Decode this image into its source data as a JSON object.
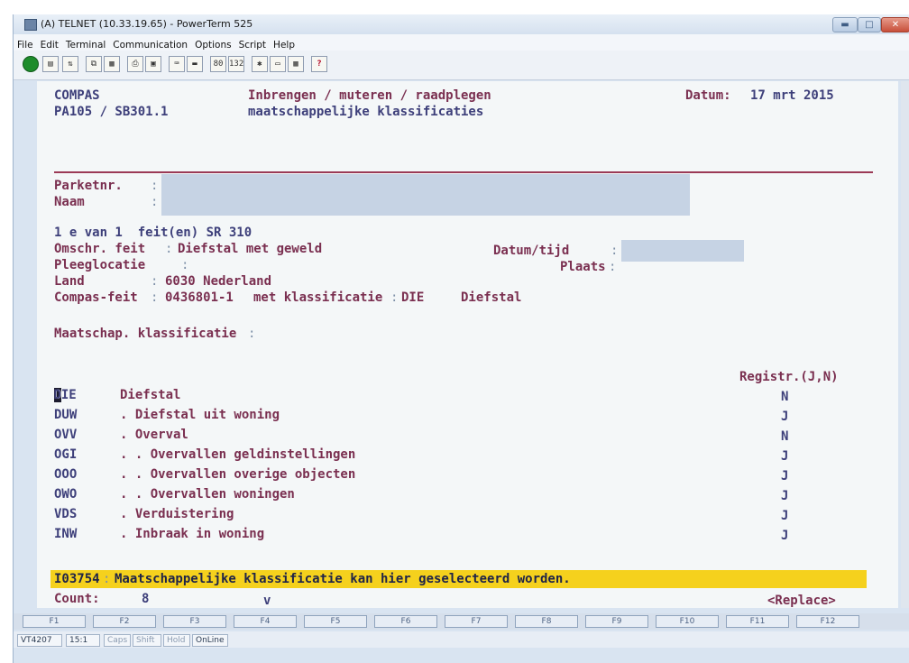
{
  "window": {
    "title": "(A) TELNET (10.33.19.65) - PowerTerm 525",
    "min_glyph": "▬",
    "max_glyph": "□",
    "close_glyph": "✕"
  },
  "menu": [
    "File",
    "Edit",
    "Terminal",
    "Communication",
    "Options",
    "Script",
    "Help"
  ],
  "toolbar": {
    "btn_80": "80",
    "btn_132": "132",
    "help": "?"
  },
  "screen": {
    "app": "COMPAS",
    "screen_id": "PA105 / SB301.1",
    "title_line1": "Inbrengen / muteren / raadplegen",
    "title_line2": "maatschappelijke klassificaties",
    "date_label": "Datum:",
    "date_value": "17 mrt 2015",
    "parketnr_label": "Parketnr.",
    "naam_label": "Naam",
    "colon": ":",
    "feit_count": "1 e van 1  feit(en) SR 310",
    "omschr_label": "Omschr. feit",
    "omschr_value": "Diefstal met geweld",
    "datumtijd_label": "Datum/tijd",
    "pleeg_label": "Pleeglocatie",
    "plaats_label": "Plaats",
    "land_label": "Land",
    "land_value": "6030 Nederland",
    "compas_label": "Compas-feit",
    "compas_value": "0436801-1",
    "met_klass_label": "met klassificatie",
    "klass_code": "DIE",
    "klass_name": "Diefstal",
    "maatschap_label": "Maatschap. klassificatie",
    "registr_label": "Registr.(J,N)",
    "rows": [
      {
        "code": "DIE",
        "desc": "Diefstal",
        "reg": "N"
      },
      {
        "code": "DUW",
        "desc": ". Diefstal uit woning",
        "reg": "J"
      },
      {
        "code": "OVV",
        "desc": ". Overval",
        "reg": "N"
      },
      {
        "code": "OGI",
        "desc": ". . Overvallen geldinstellingen",
        "reg": "J"
      },
      {
        "code": "OOO",
        "desc": ". . Overvallen overige objecten",
        "reg": "J"
      },
      {
        "code": "OWO",
        "desc": ". . Overvallen woningen",
        "reg": "J"
      },
      {
        "code": "VDS",
        "desc": ". Verduistering",
        "reg": "J"
      },
      {
        "code": "INW",
        "desc": ". Inbraak in woning",
        "reg": "J"
      }
    ],
    "message_code": "I03754",
    "message_text": "Maatschappelijke klassificatie kan hier geselecteerd worden.",
    "count_label": "Count:",
    "count_value": "8",
    "v_marker": "v",
    "replace": "<Replace>"
  },
  "fkeys": [
    "F1",
    "F2",
    "F3",
    "F4",
    "F5",
    "F6",
    "F7",
    "F8",
    "F9",
    "F10",
    "F11",
    "F12"
  ],
  "status": {
    "terminal": "VT4207",
    "line": "15:1",
    "caps": "Caps",
    "shift": "Shift",
    "hold": "Hold",
    "online": "OnLine"
  },
  "colors": {
    "highlight": "#f5d11d",
    "label_text": "#7a2f50",
    "value_text": "#3d3f7a",
    "input_field": "#c6d3e4"
  }
}
